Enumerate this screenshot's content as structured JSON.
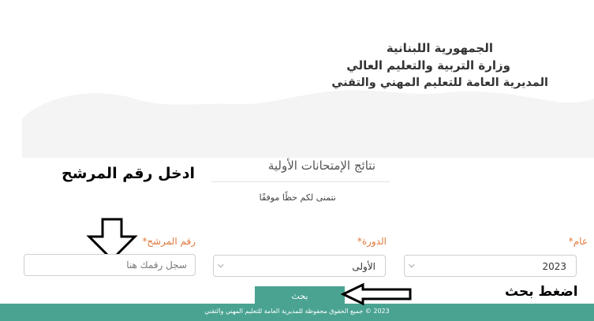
{
  "header": {
    "line1": "الجمهورية اللبنانية",
    "line2": "وزارة التربية والتعليم العالي",
    "line3": "المديرية العامة للتعليم المهني والتقني"
  },
  "results": {
    "title": "نتائج الإمتحانات الأولية",
    "wish": "نتمنى لكم حظًا موفقًا"
  },
  "annotations": {
    "enter_candidate": "ادخل رقم المرشح",
    "press_search": "اضغط بحث"
  },
  "form": {
    "year": {
      "label": "عام",
      "required_mark": "*",
      "value": "2023"
    },
    "session": {
      "label": "الدورة",
      "required_mark": "*",
      "value": "الأولى"
    },
    "candidate": {
      "label": "رقم المرشح",
      "required_mark": "*",
      "placeholder": "سجل رقمك هنا"
    }
  },
  "search_button": {
    "label": "بحث"
  },
  "footer": {
    "text": "2023 © جميع الحقوق محفوظة للمديرية العامة للتعليم المهني والتقني"
  },
  "colors": {
    "accent": "#4aa391",
    "label": "#e07a3c",
    "wave": "#f3f3f3"
  },
  "icons": {
    "down_arrow": "down-arrow-icon",
    "left_arrow": "left-arrow-icon",
    "chevron": "chevron-down-icon"
  }
}
